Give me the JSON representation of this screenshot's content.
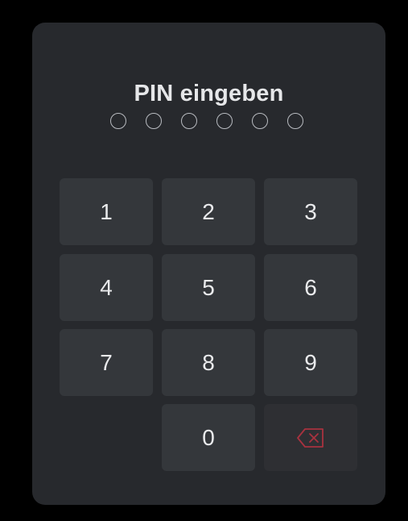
{
  "dialog": {
    "title": "PIN eingeben",
    "pin_length": 6,
    "entered_digits": 0
  },
  "keypad": {
    "keys": [
      "1",
      "2",
      "3",
      "4",
      "5",
      "6",
      "7",
      "8",
      "9",
      "0"
    ],
    "backspace_icon": "backspace-icon"
  },
  "colors": {
    "background": "#000000",
    "card": "#27292d",
    "key": "#34373b",
    "text": "#e9eaec",
    "backspace_accent": "#a8323f"
  }
}
